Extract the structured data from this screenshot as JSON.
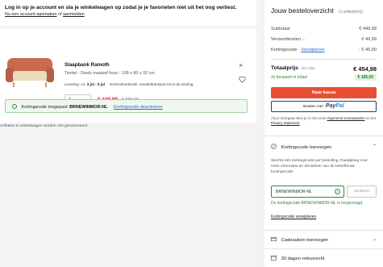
{
  "login": {
    "title": "Log in op je account en sla je winkelwagen op zodat je je favorieten niet uit het oog verliest.",
    "link_register": "Nu een account aanmaken",
    "or_text": "of",
    "link_login": "aanmelden"
  },
  "product": {
    "name": "Slaapbank Ramoth",
    "description": "Textiel - Deels massief hout - 138 x 80 x 92 cm",
    "delivery_label": "Levering: ca.",
    "delivery_date": "3 jul - 5 jul",
    "shipping_method": "Verzendmethode: meubeltransport tot in de woning",
    "quantity": "1",
    "price_now": "€ 449,99",
    "price_old": "€ 569,99",
    "sofa_colors": {
      "body": "#c96a4f",
      "seat": "#e8dcbc",
      "legs": "#c7a06a"
    }
  },
  "coupon_applied": {
    "label": "Kortingscode toegepast:",
    "code": "BRNEWINMOR-NL",
    "deactivate": "Kortingscode deactiveren"
  },
  "note": "Artikelen in winkelwagen worden niet gereserveerd.",
  "overview": {
    "title": "Jouw besteloverzicht",
    "count": "(1 artikel(en))",
    "subtotal_label": "Subtotaal",
    "subtotal_value": "€ 449,99",
    "shipping_label": "Verzendkosten",
    "shipping_value": "€ 49,99",
    "discount_label": "Kortingscode",
    "discount_remove": "Verwijderen",
    "discount_value": "- € 45,00",
    "total_label": "Totaalprijs",
    "total_vat": "incl. btw",
    "total_value": "€ 454,98",
    "saved_label": "Je bespaart in totaal",
    "saved_value": "€ 165,00",
    "checkout_label": "Naar kassa",
    "paypal_prefix": "Betalen met",
    "paypal_pay": "Pay",
    "paypal_pal": "Pal",
    "terms_pre": "Als je doorgaat stem je in met onze",
    "terms_link": "Algemene Voorwaarden",
    "terms_mid": "en het",
    "privacy_link": "Privacy Statement",
    "accent": "#e94f35"
  },
  "coupon_section": {
    "title": "Kortingscode toevoegen",
    "body": "Slechts één kortingscode per bestelling. Raadpleeg voor meer informatie de disclaimer van de betreffende kortingscode.",
    "input_value": "BRNEWINMOR-NL",
    "verify_label": "Verifiëren",
    "success": "De kortingscode BRNEWINMOR-NL is toegevoegd.",
    "remove_link": "Kortingscode verwijderen"
  },
  "gift_section": {
    "title": "Cadeaubon toevoegen"
  },
  "return_section": {
    "title": "30 dagen retourrecht"
  }
}
